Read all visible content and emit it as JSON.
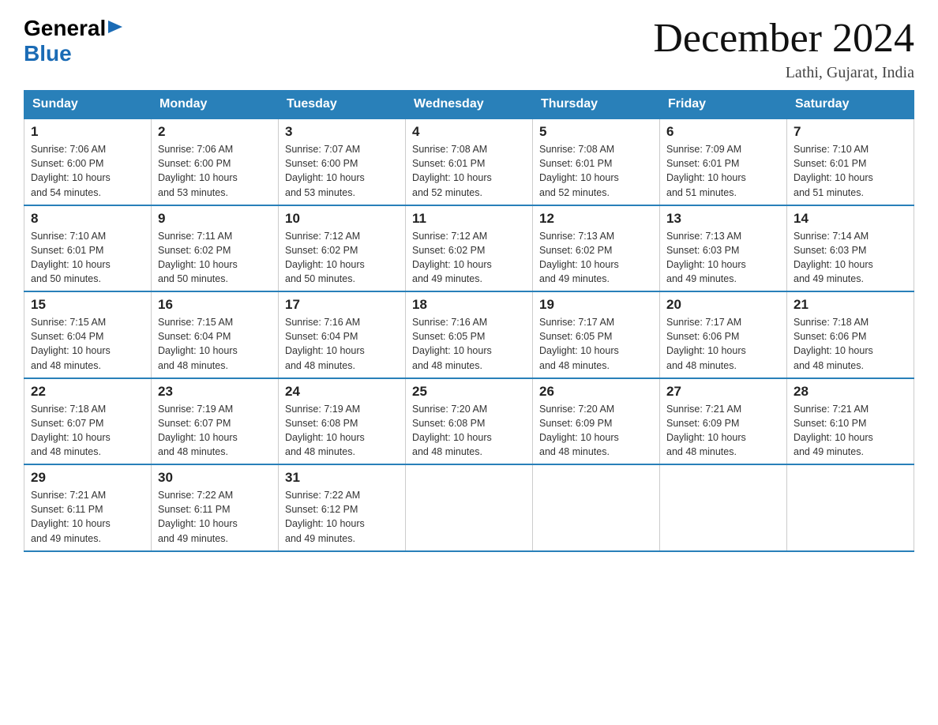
{
  "logo": {
    "general": "General",
    "blue": "Blue"
  },
  "title": "December 2024",
  "location": "Lathi, Gujarat, India",
  "weekdays": [
    "Sunday",
    "Monday",
    "Tuesday",
    "Wednesday",
    "Thursday",
    "Friday",
    "Saturday"
  ],
  "weeks": [
    [
      {
        "day": "1",
        "sunrise": "7:06 AM",
        "sunset": "6:00 PM",
        "daylight": "10 hours and 54 minutes."
      },
      {
        "day": "2",
        "sunrise": "7:06 AM",
        "sunset": "6:00 PM",
        "daylight": "10 hours and 53 minutes."
      },
      {
        "day": "3",
        "sunrise": "7:07 AM",
        "sunset": "6:00 PM",
        "daylight": "10 hours and 53 minutes."
      },
      {
        "day": "4",
        "sunrise": "7:08 AM",
        "sunset": "6:01 PM",
        "daylight": "10 hours and 52 minutes."
      },
      {
        "day": "5",
        "sunrise": "7:08 AM",
        "sunset": "6:01 PM",
        "daylight": "10 hours and 52 minutes."
      },
      {
        "day": "6",
        "sunrise": "7:09 AM",
        "sunset": "6:01 PM",
        "daylight": "10 hours and 51 minutes."
      },
      {
        "day": "7",
        "sunrise": "7:10 AM",
        "sunset": "6:01 PM",
        "daylight": "10 hours and 51 minutes."
      }
    ],
    [
      {
        "day": "8",
        "sunrise": "7:10 AM",
        "sunset": "6:01 PM",
        "daylight": "10 hours and 50 minutes."
      },
      {
        "day": "9",
        "sunrise": "7:11 AM",
        "sunset": "6:02 PM",
        "daylight": "10 hours and 50 minutes."
      },
      {
        "day": "10",
        "sunrise": "7:12 AM",
        "sunset": "6:02 PM",
        "daylight": "10 hours and 50 minutes."
      },
      {
        "day": "11",
        "sunrise": "7:12 AM",
        "sunset": "6:02 PM",
        "daylight": "10 hours and 49 minutes."
      },
      {
        "day": "12",
        "sunrise": "7:13 AM",
        "sunset": "6:02 PM",
        "daylight": "10 hours and 49 minutes."
      },
      {
        "day": "13",
        "sunrise": "7:13 AM",
        "sunset": "6:03 PM",
        "daylight": "10 hours and 49 minutes."
      },
      {
        "day": "14",
        "sunrise": "7:14 AM",
        "sunset": "6:03 PM",
        "daylight": "10 hours and 49 minutes."
      }
    ],
    [
      {
        "day": "15",
        "sunrise": "7:15 AM",
        "sunset": "6:04 PM",
        "daylight": "10 hours and 48 minutes."
      },
      {
        "day": "16",
        "sunrise": "7:15 AM",
        "sunset": "6:04 PM",
        "daylight": "10 hours and 48 minutes."
      },
      {
        "day": "17",
        "sunrise": "7:16 AM",
        "sunset": "6:04 PM",
        "daylight": "10 hours and 48 minutes."
      },
      {
        "day": "18",
        "sunrise": "7:16 AM",
        "sunset": "6:05 PM",
        "daylight": "10 hours and 48 minutes."
      },
      {
        "day": "19",
        "sunrise": "7:17 AM",
        "sunset": "6:05 PM",
        "daylight": "10 hours and 48 minutes."
      },
      {
        "day": "20",
        "sunrise": "7:17 AM",
        "sunset": "6:06 PM",
        "daylight": "10 hours and 48 minutes."
      },
      {
        "day": "21",
        "sunrise": "7:18 AM",
        "sunset": "6:06 PM",
        "daylight": "10 hours and 48 minutes."
      }
    ],
    [
      {
        "day": "22",
        "sunrise": "7:18 AM",
        "sunset": "6:07 PM",
        "daylight": "10 hours and 48 minutes."
      },
      {
        "day": "23",
        "sunrise": "7:19 AM",
        "sunset": "6:07 PM",
        "daylight": "10 hours and 48 minutes."
      },
      {
        "day": "24",
        "sunrise": "7:19 AM",
        "sunset": "6:08 PM",
        "daylight": "10 hours and 48 minutes."
      },
      {
        "day": "25",
        "sunrise": "7:20 AM",
        "sunset": "6:08 PM",
        "daylight": "10 hours and 48 minutes."
      },
      {
        "day": "26",
        "sunrise": "7:20 AM",
        "sunset": "6:09 PM",
        "daylight": "10 hours and 48 minutes."
      },
      {
        "day": "27",
        "sunrise": "7:21 AM",
        "sunset": "6:09 PM",
        "daylight": "10 hours and 48 minutes."
      },
      {
        "day": "28",
        "sunrise": "7:21 AM",
        "sunset": "6:10 PM",
        "daylight": "10 hours and 49 minutes."
      }
    ],
    [
      {
        "day": "29",
        "sunrise": "7:21 AM",
        "sunset": "6:11 PM",
        "daylight": "10 hours and 49 minutes."
      },
      {
        "day": "30",
        "sunrise": "7:22 AM",
        "sunset": "6:11 PM",
        "daylight": "10 hours and 49 minutes."
      },
      {
        "day": "31",
        "sunrise": "7:22 AM",
        "sunset": "6:12 PM",
        "daylight": "10 hours and 49 minutes."
      },
      null,
      null,
      null,
      null
    ]
  ],
  "labels": {
    "sunrise": "Sunrise:",
    "sunset": "Sunset:",
    "daylight": "Daylight:"
  }
}
